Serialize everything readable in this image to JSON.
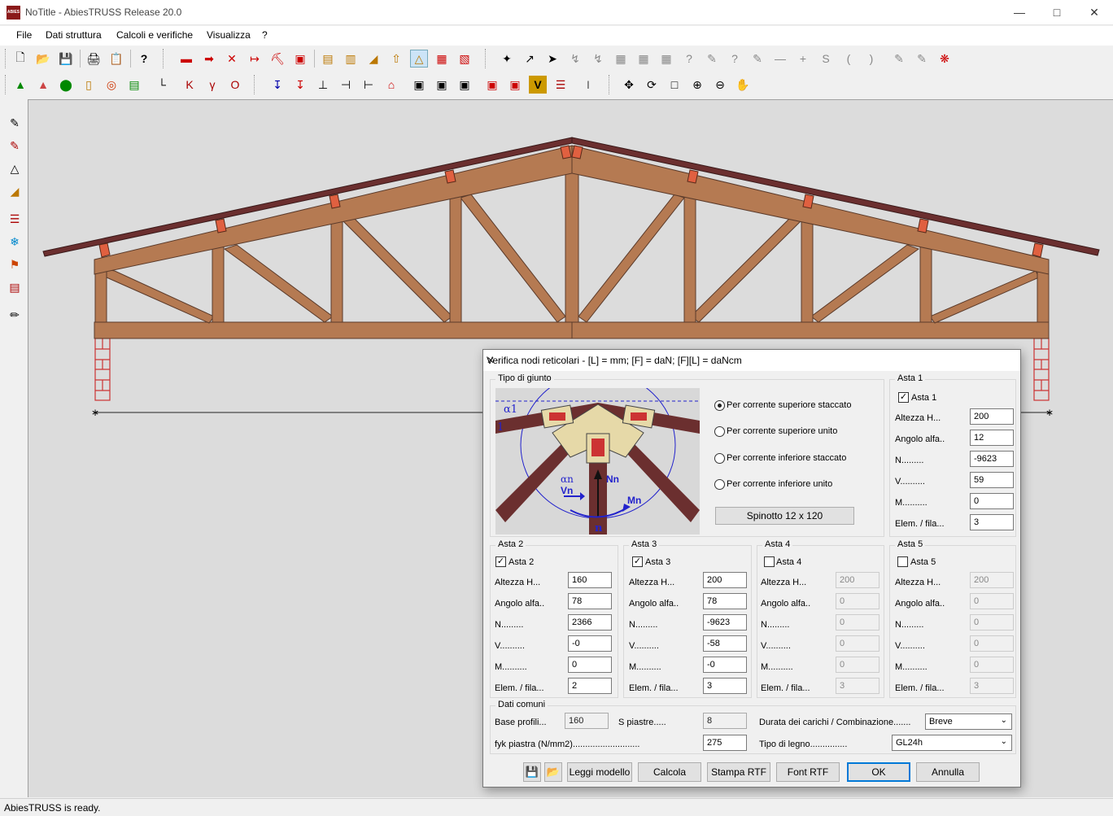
{
  "window": {
    "title": "NoTitle - AbiesTRUSS Release 20.0",
    "app_icon": "ABIES"
  },
  "menu": [
    "File",
    "Dati struttura",
    "Calcoli e verifiche",
    "Visualizza",
    "?"
  ],
  "status": "AbiesTRUSS is ready.",
  "dialog": {
    "title": "Verifica nodi reticolari - [L] = mm; [F] = daN; [F][L] = daNcm",
    "joint_group": "Tipo di giunto",
    "radios": [
      {
        "label": "Per corrente superiore staccato",
        "checked": true
      },
      {
        "label": "Per corrente superiore unito",
        "checked": false
      },
      {
        "label": "Per corrente inferiore staccato",
        "checked": false
      },
      {
        "label": "Per corrente inferiore unito",
        "checked": false
      }
    ],
    "spinotto_button": "Spinotto 12 x 120",
    "diagram_labels": {
      "alpha1": "α1",
      "one": "1",
      "alpha_n": "αn",
      "vn": "Vn",
      "nn": "Nn",
      "mn": "Mn",
      "n": "n"
    },
    "field_labels": [
      "Altezza H...",
      "Angolo alfa..",
      "N.........",
      "V..........",
      "M..........",
      "Elem. / fila..."
    ],
    "aste": [
      {
        "group": "Asta 1",
        "check": "Asta 1",
        "checked": true,
        "values": [
          "200",
          "12",
          "-9623",
          "59",
          "0",
          "3"
        ]
      },
      {
        "group": "Asta 2",
        "check": "Asta 2",
        "checked": true,
        "values": [
          "160",
          "78",
          "2366",
          "-0",
          "0",
          "2"
        ]
      },
      {
        "group": "Asta 3",
        "check": "Asta 3",
        "checked": true,
        "values": [
          "200",
          "78",
          "-9623",
          "-58",
          "-0",
          "3"
        ]
      },
      {
        "group": "Asta 4",
        "check": "Asta 4",
        "checked": false,
        "values": [
          "200",
          "0",
          "0",
          "0",
          "0",
          "3"
        ]
      },
      {
        "group": "Asta 5",
        "check": "Asta 5",
        "checked": false,
        "values": [
          "200",
          "0",
          "0",
          "0",
          "0",
          "3"
        ]
      }
    ],
    "common": {
      "group": "Dati comuni",
      "base_label": "Base profili...",
      "base_value": "160",
      "s_label": "S piastre.....",
      "s_value": "8",
      "fyk_label": "fyk piastra (N/mm2)...........................",
      "fyk_value": "275",
      "durata_label": "Durata dei carichi / Combinazione.......",
      "durata_value": "Breve",
      "tipo_label": "Tipo di legno...............",
      "tipo_value": "GL24h"
    },
    "buttons": {
      "leggi": "Leggi modello",
      "calcola": "Calcola",
      "stampa": "Stampa RTF",
      "font": "Font RTF",
      "ok": "OK",
      "annulla": "Annulla"
    }
  },
  "colors": {
    "wood": "#b57a52",
    "wood_dark": "#6b2f2f",
    "plate": "#e06040",
    "brick": "#cc3333"
  }
}
